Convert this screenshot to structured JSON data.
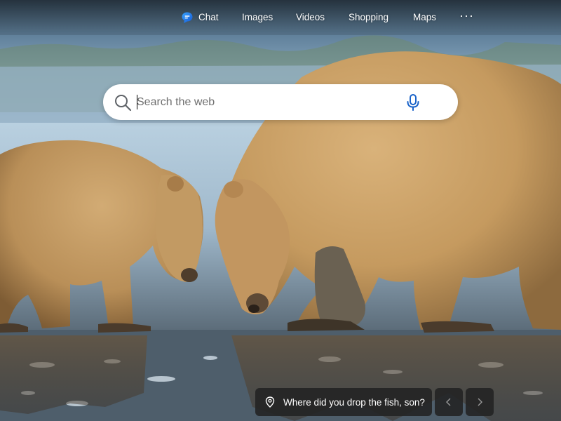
{
  "nav": {
    "chat": "Chat",
    "images": "Images",
    "videos": "Videos",
    "shopping": "Shopping",
    "maps": "Maps",
    "more": "···"
  },
  "search": {
    "placeholder": "Search the web",
    "value": ""
  },
  "caption": {
    "text": "Where did you drop the fish, son?"
  },
  "icons": {
    "chat": "chat-bubble-icon",
    "search": "search-icon",
    "mic": "microphone-icon",
    "location": "location-pin-icon",
    "prev": "chevron-left-icon",
    "next": "chevron-right-icon"
  },
  "colors": {
    "chat_icon": "#1a73e8",
    "mic": "#1a63c9",
    "caption_bg": "#222222"
  }
}
